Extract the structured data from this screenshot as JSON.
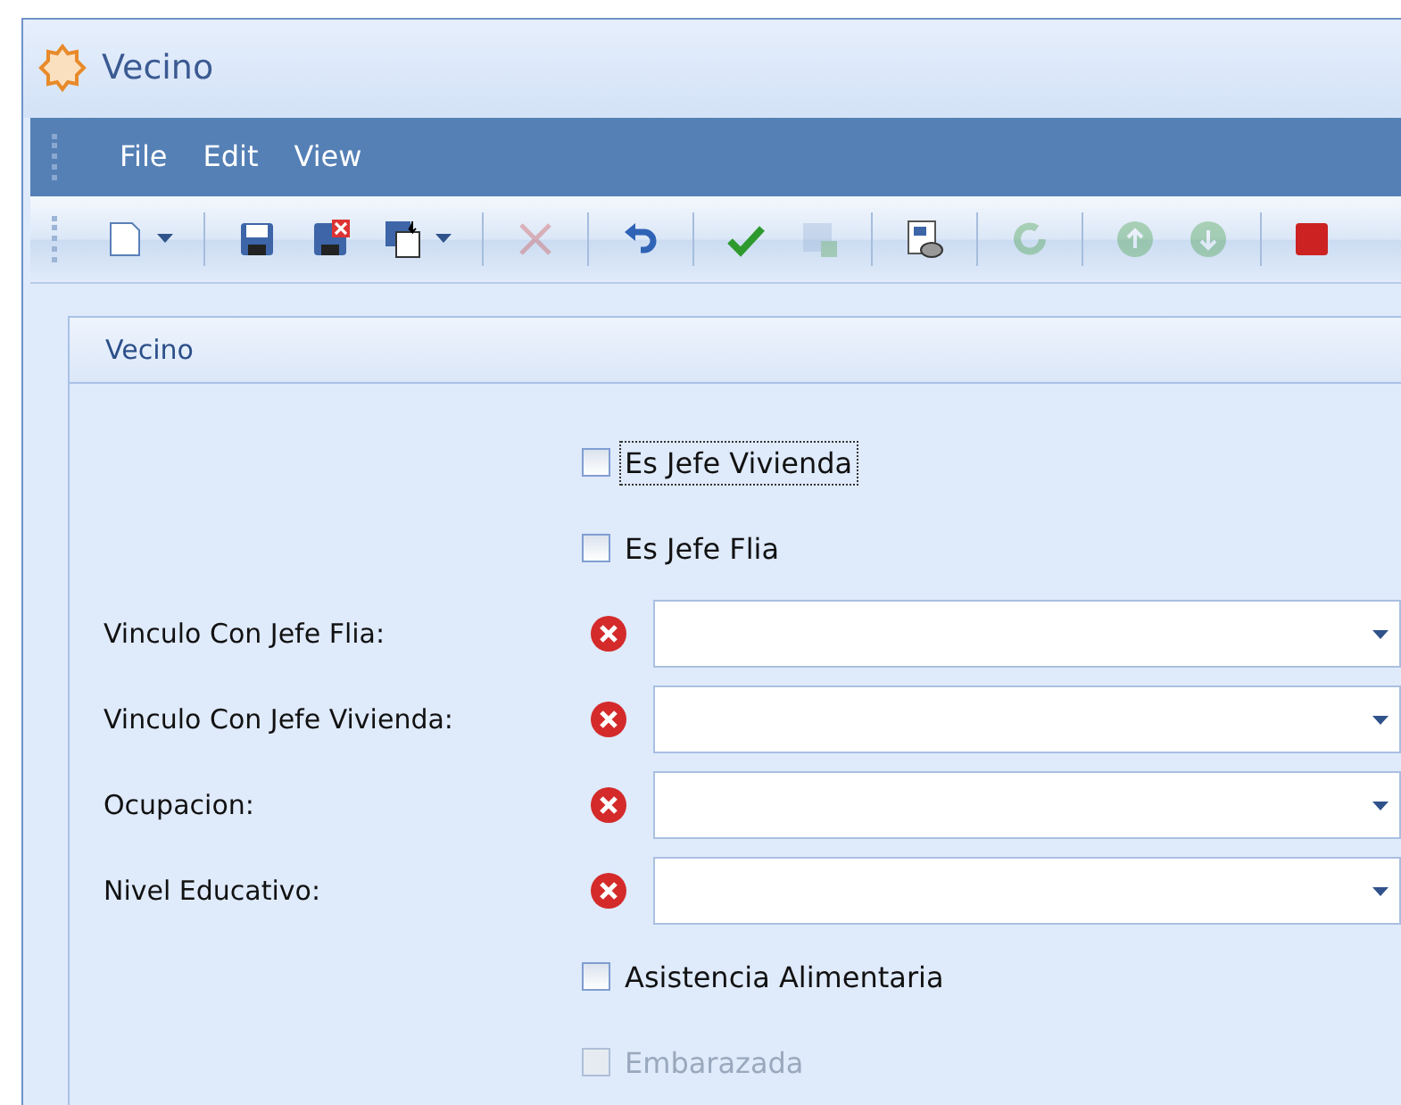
{
  "window": {
    "title": "Vecino"
  },
  "menu": [
    "File",
    "Edit",
    "View"
  ],
  "toolbar": [
    {
      "kind": "new",
      "disabled": false,
      "dropdown": true
    },
    {
      "kind": "sep"
    },
    {
      "kind": "save",
      "disabled": false
    },
    {
      "kind": "save-close",
      "disabled": false
    },
    {
      "kind": "save-many",
      "disabled": false,
      "dropdown": true
    },
    {
      "kind": "sep"
    },
    {
      "kind": "delete",
      "disabled": true
    },
    {
      "kind": "sep"
    },
    {
      "kind": "undo",
      "disabled": false
    },
    {
      "kind": "sep"
    },
    {
      "kind": "check",
      "disabled": false
    },
    {
      "kind": "grid",
      "disabled": true
    },
    {
      "kind": "sep"
    },
    {
      "kind": "preview",
      "disabled": false
    },
    {
      "kind": "sep"
    },
    {
      "kind": "refresh",
      "disabled": true
    },
    {
      "kind": "sep"
    },
    {
      "kind": "up",
      "disabled": true
    },
    {
      "kind": "down",
      "disabled": true
    },
    {
      "kind": "sep"
    },
    {
      "kind": "stop",
      "disabled": false
    }
  ],
  "group": {
    "title": "Vecino",
    "rows": [
      {
        "kind": "checkbox",
        "label": "Es Jefe Vivienda",
        "checked": false,
        "focused": true,
        "disabled": false
      },
      {
        "kind": "checkbox",
        "label": "Es Jefe Flia",
        "checked": false,
        "focused": false,
        "disabled": false
      },
      {
        "kind": "combo",
        "label": "Vinculo Con Jefe Flia:",
        "error": true
      },
      {
        "kind": "combo",
        "label": "Vinculo Con Jefe Vivienda:",
        "error": true
      },
      {
        "kind": "combo",
        "label": "Ocupacion:",
        "error": true
      },
      {
        "kind": "combo",
        "label": "Nivel Educativo:",
        "error": true
      },
      {
        "kind": "checkbox",
        "label": "Asistencia Alimentaria",
        "checked": false,
        "focused": false,
        "disabled": false
      },
      {
        "kind": "checkbox",
        "label": "Embarazada",
        "checked": false,
        "focused": false,
        "disabled": true
      }
    ]
  }
}
